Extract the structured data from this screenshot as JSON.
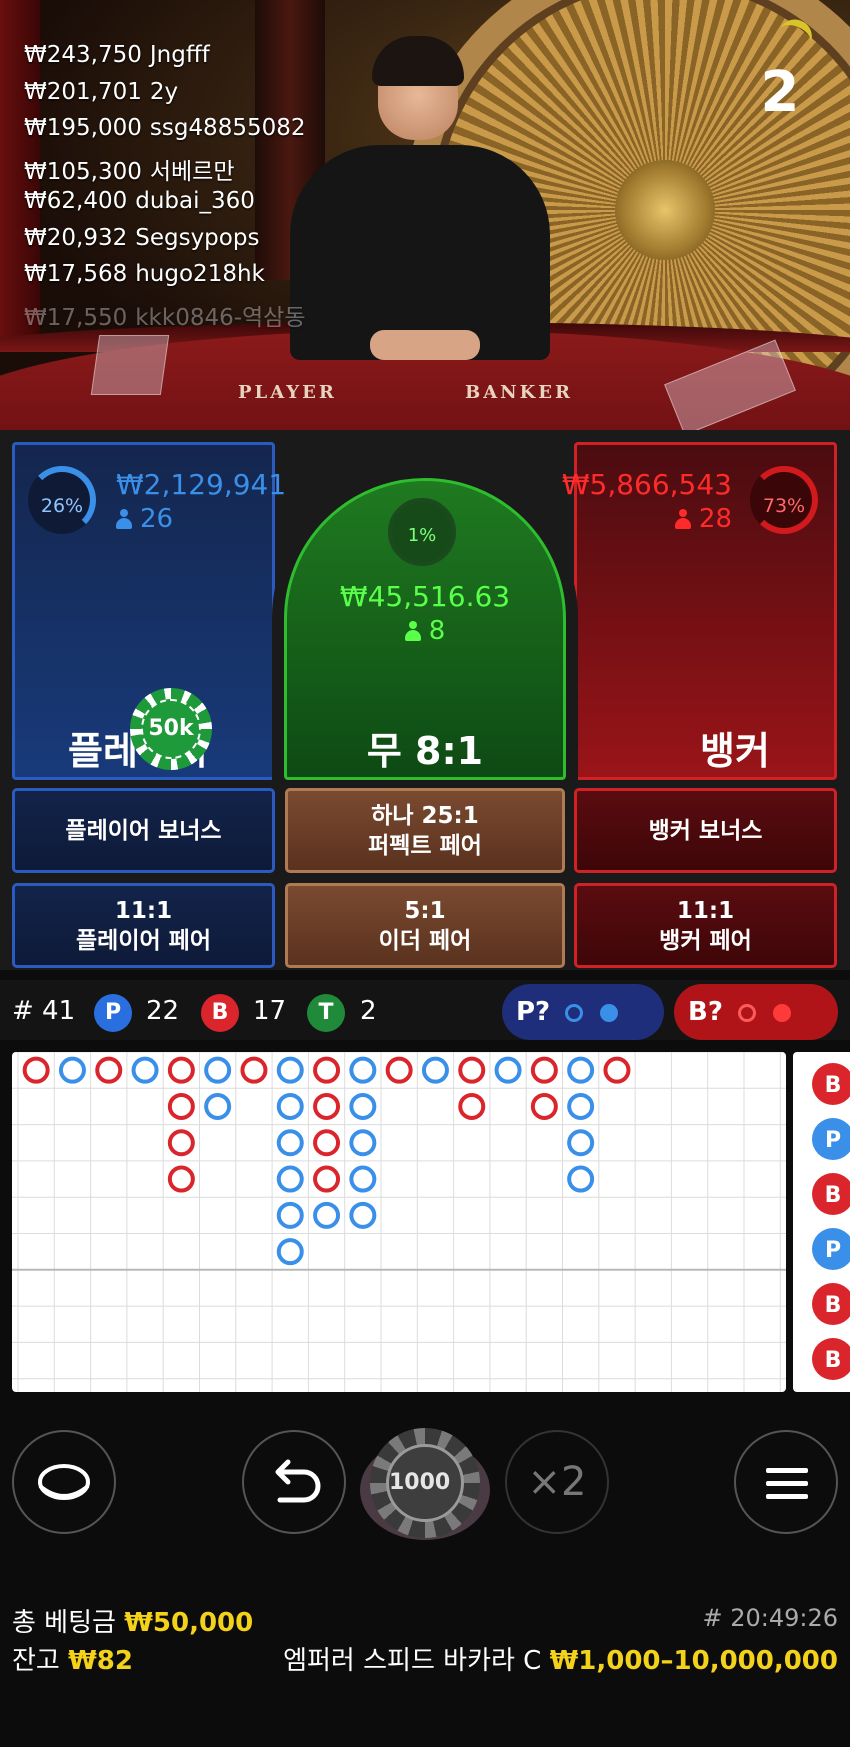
{
  "countdown": "2",
  "felt": {
    "player_label": "PLAYER",
    "banker_label": "BANKER"
  },
  "winners": [
    {
      "amount": "₩243,750",
      "name": "Jngfff"
    },
    {
      "amount": "₩201,701",
      "name": "2y"
    },
    {
      "amount": "₩195,000",
      "name": "ssg48855082"
    },
    {
      "amount": "₩105,300",
      "name": "서베르만"
    },
    {
      "amount": "₩62,400",
      "name": "dubai_360"
    },
    {
      "amount": "₩20,932",
      "name": "Segsypops"
    },
    {
      "amount": "₩17,568",
      "name": "hugo218hk"
    },
    {
      "amount": "₩17,550",
      "name": "kkk0846-역삼동"
    }
  ],
  "player": {
    "percent": "26%",
    "amount": "₩2,129,941",
    "count": "26",
    "label": "플레이어",
    "percent_value": 0.26
  },
  "tie": {
    "percent": "1%",
    "amount": "₩45,516.63",
    "count": "8",
    "label": "무 8:1",
    "percent_value": 0.01
  },
  "banker": {
    "percent": "73%",
    "amount": "₩5,866,543",
    "count": "28",
    "label": "뱅커",
    "percent_value": 0.73
  },
  "placed_chip": "50k",
  "side_bets": {
    "player_bonus": "플레이어 보너스",
    "perfect_pair_line1": "하나 25:1",
    "perfect_pair_line2": "퍼펙트 페어",
    "banker_bonus": "뱅커 보너스",
    "player_pair_line1": "11:1",
    "player_pair_line2": "플레이어 페어",
    "either_pair_line1": "5:1",
    "either_pair_line2": "이더 페어",
    "banker_pair_line1": "11:1",
    "banker_pair_line2": "뱅커 페어"
  },
  "stats": {
    "round": "# 41",
    "p_badge": "P",
    "p_count": "22",
    "b_badge": "B",
    "b_count": "17",
    "t_badge": "T",
    "t_count": "2",
    "predict_p": "P?",
    "predict_b": "B?"
  },
  "colors": {
    "player": "#2a5bc0",
    "banker": "#d02226",
    "tie": "#2ebd2e",
    "road_red": "#d9252b",
    "road_blue": "#3a8fe8",
    "accent_yellow": "#f5d21a"
  },
  "big_road": [
    [
      "B"
    ],
    [
      "P"
    ],
    [
      "B"
    ],
    [
      "P"
    ],
    [
      "B",
      "B",
      "B",
      "B"
    ],
    [
      "P",
      "P"
    ],
    [
      "B"
    ],
    [
      "P",
      "P",
      "P",
      "P",
      "P",
      "P"
    ],
    [
      "B",
      "B",
      "B",
      "B",
      "P"
    ],
    [
      "P",
      "P",
      "P",
      "P",
      "P"
    ],
    [
      "B"
    ],
    [
      "P"
    ],
    [
      "B",
      "B"
    ],
    [
      "P"
    ],
    [
      "B",
      "B"
    ],
    [
      "P",
      "P",
      "P",
      "P"
    ],
    [
      "B"
    ]
  ],
  "side_road": [
    "B",
    "P",
    "B",
    "P",
    "B",
    "B"
  ],
  "controls": {
    "chip_value": "1000",
    "double_label": "×2"
  },
  "footer": {
    "total_label": "총 베팅금",
    "total_value": "₩50,000",
    "balance_label": "잔고",
    "balance_value": "₩82",
    "clock": "# 20:49:26",
    "table_name": "엠퍼러 스피드 바카라 C",
    "limits": "₩1,000–10,000,000"
  },
  "icons": [
    "lobby-icon",
    "undo-icon",
    "menu-icon",
    "person-icon"
  ]
}
